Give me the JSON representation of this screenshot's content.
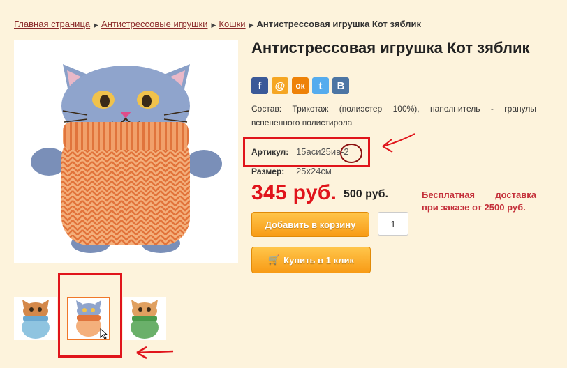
{
  "breadcrumb": {
    "home": "Главная страница",
    "category": "Антистрессовые игрушки",
    "subcategory": "Кошки",
    "current": "Антистрессовая игрушка Кот зяблик"
  },
  "product": {
    "title": "Антистрессовая игрушка Кот зяблик",
    "description_label": "Состав",
    "description": ": Трикотаж (полиэстер 100%), наполнитель - гранулы вспененного полистирола",
    "article_label": "Артикул:",
    "article_value": "15аси25ив-2",
    "size_label": "Размер:",
    "size_value": "25x24см",
    "price": "345 руб.",
    "old_price": "500 руб.",
    "delivery": "Бесплатная доставка при заказе от 2500 руб.",
    "add_to_cart": "Добавить в корзину",
    "quantity": "1",
    "buy_one_click": "Купить в 1 клик"
  },
  "social": [
    {
      "icon": "facebook-icon",
      "glyph": "f",
      "color": "#3b5998"
    },
    {
      "icon": "mail-icon",
      "glyph": "@",
      "color": "#f5a623"
    },
    {
      "icon": "odnoklassniki-icon",
      "glyph": "ок",
      "color": "#ee8208"
    },
    {
      "icon": "twitter-icon",
      "glyph": "t",
      "color": "#55acee"
    },
    {
      "icon": "vk-icon",
      "glyph": "B",
      "color": "#4c75a3"
    }
  ],
  "colors": {
    "link": "#8b2a2a",
    "price": "#e0141b",
    "delivery": "#c4303a",
    "button": "#f89b16",
    "annotation": "#e0141b"
  }
}
